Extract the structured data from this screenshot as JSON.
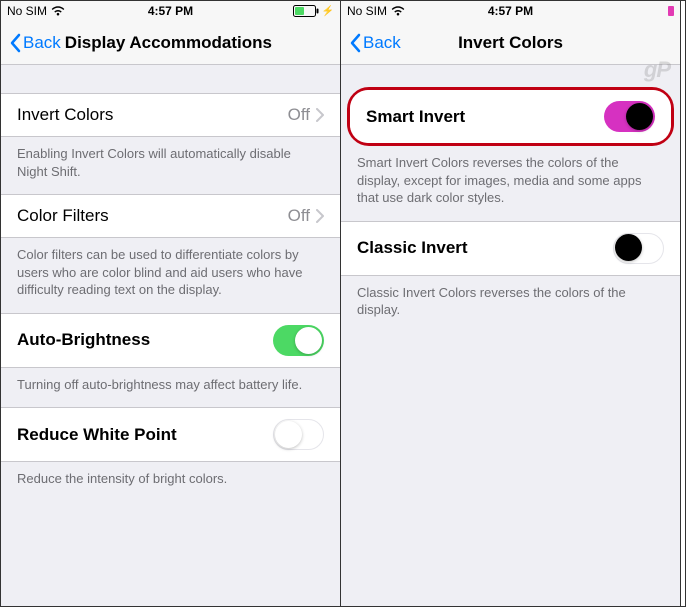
{
  "left": {
    "status": {
      "carrier": "No SIM",
      "time": "4:57 PM"
    },
    "nav": {
      "back": "Back",
      "title": "Display Accommodations"
    },
    "rows": {
      "invert": {
        "label": "Invert Colors",
        "value": "Off"
      },
      "invertFooter": "Enabling Invert Colors will automatically disable Night Shift.",
      "colorFilters": {
        "label": "Color Filters",
        "value": "Off"
      },
      "colorFiltersFooter": "Color filters can be used to differentiate colors by users who are color blind and aid users who have difficulty reading text on the display.",
      "autoBrightness": {
        "label": "Auto-Brightness"
      },
      "autoBrightnessFooter": "Turning off auto-brightness may affect battery life.",
      "reduceWhite": {
        "label": "Reduce White Point"
      },
      "reduceWhiteFooter": "Reduce the intensity of bright colors."
    }
  },
  "right": {
    "status": {
      "carrier": "No SIM",
      "time": "4:57 PM"
    },
    "nav": {
      "back": "Back",
      "title": "Invert Colors"
    },
    "rows": {
      "smartInvert": {
        "label": "Smart Invert"
      },
      "smartInvertFooter": "Smart Invert Colors reverses the colors of the display, except for images, media and some apps that use dark color styles.",
      "classicInvert": {
        "label": "Classic Invert"
      },
      "classicInvertFooter": "Classic Invert Colors reverses the colors of the display."
    },
    "watermark": "gP"
  }
}
